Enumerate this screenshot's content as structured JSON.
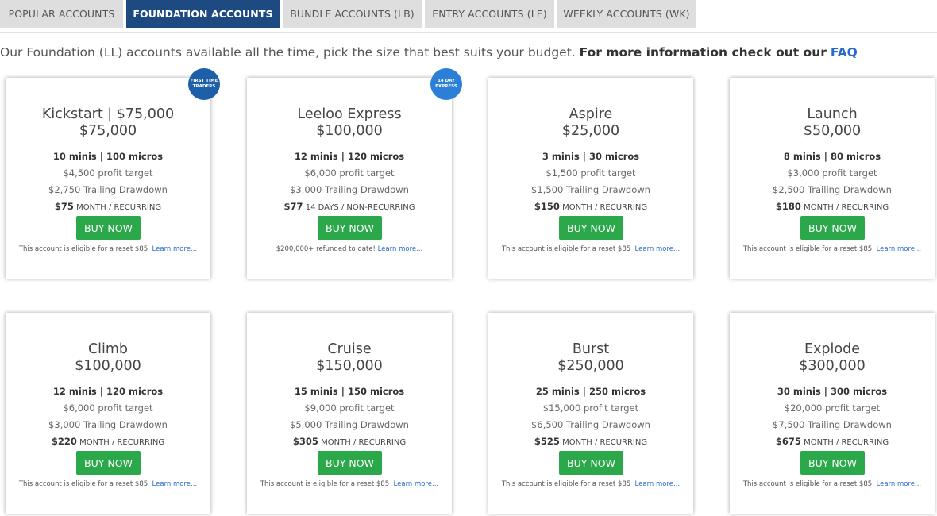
{
  "tabs": [
    {
      "label": "POPULAR ACCOUNTS"
    },
    {
      "label": "FOUNDATION ACCOUNTS"
    },
    {
      "label": "BUNDLE ACCOUNTS (LB)"
    },
    {
      "label": "ENTRY ACCOUNTS (LE)"
    },
    {
      "label": "WEEKLY ACCOUNTS (WK)"
    }
  ],
  "intro": {
    "text": "Our Foundation (LL) accounts available all the time, pick the size that best suits your budget.",
    "strong": "For more information check out our",
    "faq": "FAQ"
  },
  "colors": {
    "active_tab": "#1d4a80",
    "buy_button": "#2aa84a",
    "link": "#2a6bc9"
  },
  "cards": [
    {
      "name": "Kickstart | $75,000",
      "price": "$75,000",
      "contracts": "10 minis | 100 micros",
      "profit": "$4,500 profit target",
      "drawdown": "$2,750 Trailing Drawdown",
      "fee_amount": "$75",
      "fee_term": "MONTH / RECURRING",
      "button": "BUY NOW",
      "note": "This account is eligible for a reset $85",
      "learn": "Learn more...",
      "badge": "FIRST TIME TRADERS"
    },
    {
      "name": "Leeloo Express",
      "price": "$100,000",
      "contracts": "12 minis | 120 micros",
      "profit": "$6,000 profit target",
      "drawdown": "$3,000 Trailing Drawdown",
      "fee_amount": "$77",
      "fee_term": "14 DAYS / NON-RECURRING",
      "button": "BUY NOW",
      "note": "$200,000+ refunded to date!",
      "learn": "Learn more...",
      "badge": "14 DAY EXPRESS"
    },
    {
      "name": "Aspire",
      "price": "$25,000",
      "contracts": "3 minis | 30 micros",
      "profit": "$1,500 profit target",
      "drawdown": "$1,500 Trailing Drawdown",
      "fee_amount": "$150",
      "fee_term": "MONTH / RECURRING",
      "button": "BUY NOW",
      "note": "This account is eligible for a reset $85",
      "learn": "Learn more..."
    },
    {
      "name": "Launch",
      "price": "$50,000",
      "contracts": "8 minis | 80 micros",
      "profit": "$3,000 profit target",
      "drawdown": "$2,500 Trailing Drawdown",
      "fee_amount": "$180",
      "fee_term": "MONTH / RECURRING",
      "button": "BUY NOW",
      "note": "This account is eligible for a reset $85",
      "learn": "Learn more..."
    },
    {
      "name": "Climb",
      "price": "$100,000",
      "contracts": "12 minis | 120 micros",
      "profit": "$6,000 profit target",
      "drawdown": "$3,000 Trailing Drawdown",
      "fee_amount": "$220",
      "fee_term": "MONTH / RECURRING",
      "button": "BUY NOW",
      "note": "This account is eligible for a reset $85",
      "learn": "Learn more..."
    },
    {
      "name": "Cruise",
      "price": "$150,000",
      "contracts": "15 minis | 150 micros",
      "profit": "$9,000 profit target",
      "drawdown": "$5,000 Trailing Drawdown",
      "fee_amount": "$305",
      "fee_term": "MONTH / RECURRING",
      "button": "BUY NOW",
      "note": "This account is eligible for a reset $85",
      "learn": "Learn more..."
    },
    {
      "name": "Burst",
      "price": "$250,000",
      "contracts": "25 minis | 250 micros",
      "profit": "$15,000 profit target",
      "drawdown": "$6,500 Trailing Drawdown",
      "fee_amount": "$525",
      "fee_term": "MONTH / RECURRING",
      "button": "BUY NOW",
      "note": "This account is eligible for a reset $85",
      "learn": "Learn more..."
    },
    {
      "name": "Explode",
      "price": "$300,000",
      "contracts": "30 minis | 300 micros",
      "profit": "$20,000 profit target",
      "drawdown": "$7,500 Trailing Drawdown",
      "fee_amount": "$675",
      "fee_term": "MONTH / RECURRING",
      "button": "BUY NOW",
      "note": "This account is eligible for a reset $85",
      "learn": "Learn more..."
    }
  ]
}
